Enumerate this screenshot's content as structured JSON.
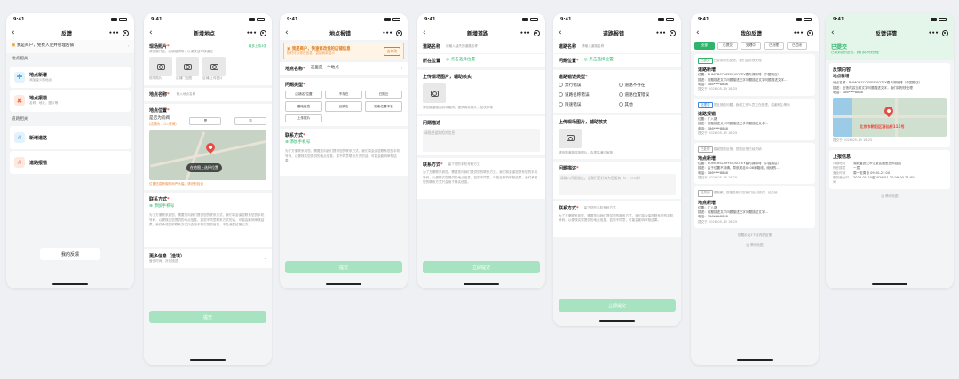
{
  "status_time": "9:41",
  "s1": {
    "title": "反馈",
    "merchant_banner": "我是商户，免费入驻并管理店铺",
    "group1": "地点相关",
    "item1_title": "地点新增",
    "item1_sub": "添加缺少的地点",
    "item2_title": "地点报错",
    "item2_sub": "名称、地址、图片等",
    "group2": "道路相关",
    "item3_title": "新增道路",
    "item4_title": "道路报错",
    "my_feedback": "我的反馈"
  },
  "s2": {
    "title": "新增地点",
    "photo_label": "现场照片",
    "photo_tip": "最多上传3张",
    "photo_hint": "请拍摄门脸、店铺招牌等，以便快速审核通过",
    "photo1": "现场照片",
    "photo2": "店铺门脸图",
    "photo3": "店铺/上传图片",
    "name_label": "地点名称",
    "name_ph": "输入地点名称",
    "position_label": "地点位置",
    "is_gate_label": "是否为房阀",
    "is_gate_sub": "(店铺为 1:1=房间)",
    "yes": "是",
    "no": "否",
    "map_btn": "在地图上选择位置",
    "map_warning": "位置信息获取时间严大幅，请识别检查",
    "contact_label": "联系方式",
    "add_phone": "添加手机号",
    "privacy": "为了方便联系到您，需要您向我们提供您的联系方式，我们将会保密联系您的手机号码，以便核实您提供的地点信息，如您不同意联系方式的话，可能会影响审核结果，我们承诺您的联系方式只会用于核实您的信息，不会泄露给第三方。",
    "more_label": "更多信息（选填）",
    "more_sub": "营业时间、补充描述",
    "submit": "提交"
  },
  "s3": {
    "title": "地点报错",
    "banner_title": "我是商户，快速修改我的店铺信息",
    "banner_sub": "随时可以修改信息，直接刷新显示",
    "banner_btn": "去修改",
    "name_label": "地点名称",
    "name_val": "这里是一个地点",
    "problem_label": "问题类型",
    "chips": [
      "店铺名/位置",
      "不存在",
      "已搬迁",
      "基础信息",
      "已换店",
      "搜索位置不准",
      "上传照片"
    ],
    "contact_label": "联系方式",
    "add_phone": "添加手机号",
    "privacy": "为了方便联系到您，需要您向我们提供您的联系方式，我们将会保密联系您的手机号码，以便核实您提供的地点信息，您不同意联系方式的话，可能会影响审核结果。",
    "submit": "提交"
  },
  "s4": {
    "title": "新增道路",
    "name_label": "道路名称",
    "name_ph": "请输入缺失的道路名称",
    "position_label": "所在位置",
    "position_val": "点击选择位置",
    "photo_label": "上传现场图片，辅助核实",
    "photo_hint": "请拍摄道路面貌和路牌，提供真实照片，加快审核",
    "desc_label": "问题描述",
    "desc_ph": "请描述道路相关信息",
    "contact_label": "联系方式",
    "contact_ph": "留下您的手机号码方式",
    "privacy": "为了方便联系到您，需要您向我们提供您的联系方式，我们将会保密联系您的手机号码，以便核实您提供的地点信息，如您不同意，可能会影响审核结果，我们承诺您的联系方式只会用于核实信息。",
    "submit": "立即提交"
  },
  "s5": {
    "title": "道路报错",
    "name_label": "道路名称",
    "name_ph": "请输入道路名称",
    "position_label": "问题位置",
    "position_val": "点击选择位置",
    "type_label": "道路错误类型",
    "radios": [
      "禁行错误",
      "道路不存在",
      "道路名称错误",
      "道路位置错误",
      "限速错误",
      "其他"
    ],
    "photo_label": "上传现场图片，辅助核实",
    "photo_hint": "请拍摄道路现场图片，会提高通过审核",
    "desc_label": "问题描述",
    "desc_ph": "请输入问题描述，让我们更好的为您服务（5~200字）",
    "contact_label": "联系方式",
    "contact_ph": "留下您的手机号码方式",
    "privacy": "为了方便联系到您，需要您向我们提供您的联系方式，我们将会保密联系您的手机号码，以便核实您提供的地点信息，如您不同意，可能会影响审核结果。",
    "submit": "立即提交"
  },
  "s6": {
    "title": "我的反馈",
    "tabs": [
      "全部",
      "已提交",
      "处理中",
      "已处理",
      "已关闭"
    ],
    "cards": [
      {
        "tag": "已提交",
        "tag_note": "已收到您的反馈，我们会尽快处理",
        "title": "道路新增",
        "l1": "位置：RUMORSCOFFEE/SOTEY春与湖咖啡（中国路店）",
        "l2": "描述：问题描述文字问题描述文字问题描述文字问题描述文字...",
        "l3": "电话：186****8888",
        "time": "提交于 2026-05-19 18:25"
      },
      {
        "tag": "处理中",
        "tag_note": "您反馈的问题，我们工作人员正在处理，感谢耐心等待",
        "title": "道路报错",
        "l1": "位置：广八路",
        "l2": "描述：问题描述文字问题描述文字问题描述文字...",
        "l3": "电话：186****8888",
        "time": "提交于 2026-05-19 18:25"
      },
      {
        "tag": "已处理",
        "tag_note": "感谢您的反馈，您的反馈已经采纳",
        "title": "地点新增",
        "l1": "位置：RUMORSCOFFEE/SOTEY春与湖咖啡（中国路店）",
        "l2": "描述：由于位置不准确，导航时走0408米路线，绕绕的...",
        "l3": "电话：186****8888",
        "time": "提交于 2026-05-19 18:25"
      },
      {
        "tag": "已关闭",
        "tag_note": "很抱歉，您报告的内容我们无法核实，已关闭",
        "title": "地点新增",
        "l1": "位置：广八路",
        "l2": "描述：问题描述文字问题描述文字问题描述文字...",
        "l3": "电话：186****8888",
        "time": "提交于 2026-05-19 18:25"
      }
    ],
    "footer": "仅展示近1个月内的反馈",
    "recommend": "腾讯地图"
  },
  "s7": {
    "title": "反馈详情",
    "status": "已提交",
    "status_sub": "已收到您的反馈，我们将尽快处理",
    "content_label": "反馈内容",
    "type_label": "地点新增",
    "d1": "地点名称：RUMORSCOFFEE/SOTEY春与湖咖啡（中国路店）",
    "d2": "描述：反馈内容当前文字问题描述文字，我们将尽快处理",
    "d3": "电话：186****8888",
    "map_label": "北京市朝阳区酒仙桥111号",
    "time": "提交于 2026-05-19 18:25",
    "extra_label": "上报信息",
    "extra_rows": [
      [
        "详细地址",
        "湖北省武汉市江夏区藏龙岛科技园"
      ],
      [
        "所在楼层",
        "一层"
      ],
      [
        "营业时间",
        "周一至周日 09:00-21:00"
      ],
      [
        "服务营业时间",
        "2026-01-20至2026-01-20 09:00-21:00"
      ]
    ],
    "recommend": "腾讯地图"
  }
}
